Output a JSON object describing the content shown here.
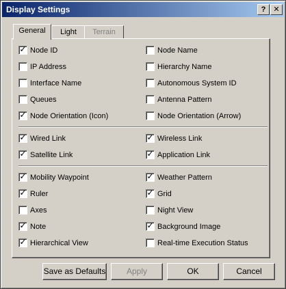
{
  "window": {
    "title": "Display Settings",
    "help_label": "?",
    "close_label": "✕"
  },
  "tabs": [
    {
      "label": "General",
      "active": true,
      "enabled": true
    },
    {
      "label": "Light",
      "active": false,
      "enabled": true
    },
    {
      "label": "Terrain",
      "active": false,
      "enabled": false
    }
  ],
  "groups": [
    [
      {
        "label": "Node ID",
        "checked": true
      },
      {
        "label": "Node Name",
        "checked": false
      },
      {
        "label": "IP Address",
        "checked": false
      },
      {
        "label": "Hierarchy Name",
        "checked": false
      },
      {
        "label": "Interface Name",
        "checked": false
      },
      {
        "label": "Autonomous System ID",
        "checked": false
      },
      {
        "label": "Queues",
        "checked": false
      },
      {
        "label": "Antenna Pattern",
        "checked": false
      },
      {
        "label": "Node Orientation (Icon)",
        "checked": true
      },
      {
        "label": "Node Orientation (Arrow)",
        "checked": false
      }
    ],
    [
      {
        "label": "Wired Link",
        "checked": true
      },
      {
        "label": "Wireless Link",
        "checked": true
      },
      {
        "label": "Satellite Link",
        "checked": true
      },
      {
        "label": "Application Link",
        "checked": true
      }
    ],
    [
      {
        "label": "Mobility Waypoint",
        "checked": true
      },
      {
        "label": "Weather Pattern",
        "checked": true
      },
      {
        "label": "Ruler",
        "checked": true
      },
      {
        "label": "Grid",
        "checked": true
      },
      {
        "label": "Axes",
        "checked": false
      },
      {
        "label": "Night View",
        "checked": false
      },
      {
        "label": "Note",
        "checked": true
      },
      {
        "label": "Background Image",
        "checked": true
      },
      {
        "label": "Hierarchical View",
        "checked": true
      },
      {
        "label": "Real-time Execution Status",
        "checked": false
      }
    ]
  ],
  "buttons": {
    "save_defaults": "Save as Defaults",
    "apply": "Apply",
    "ok": "OK",
    "cancel": "Cancel"
  },
  "check_mark": "✓"
}
